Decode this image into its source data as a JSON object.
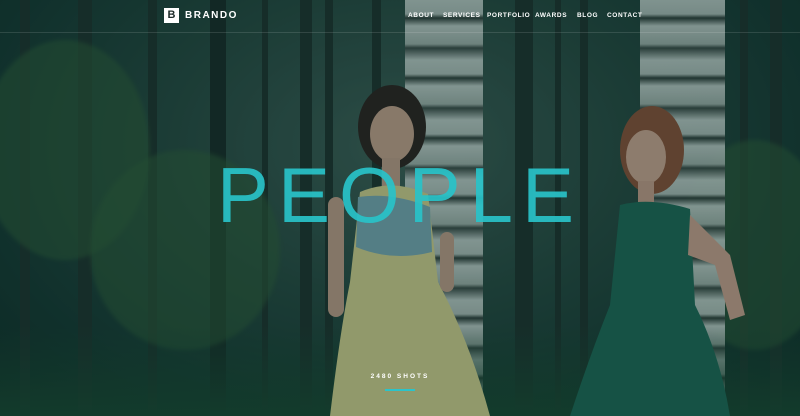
{
  "brand": {
    "logo_letter": "B",
    "name": "BRANDO"
  },
  "nav": {
    "items": [
      {
        "label": "ABOUT"
      },
      {
        "label": "SERVICES"
      },
      {
        "label": "PORTFOLIO"
      },
      {
        "label": "AWARDS"
      },
      {
        "label": "BLOG"
      },
      {
        "label": "CONTACT"
      }
    ]
  },
  "hero": {
    "title": "PEOPLE",
    "count_label": "2480 SHOTS"
  },
  "colors": {
    "accent": "#2bc4ca",
    "text": "#ffffff"
  }
}
